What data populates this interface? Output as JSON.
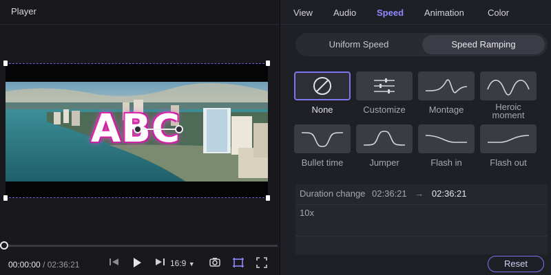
{
  "player": {
    "title": "Player",
    "overlay_text": "ABC",
    "current_time": "00:00:00",
    "separator": "/",
    "total_time": "02:36:21",
    "aspect_ratio": "16:9",
    "playhead_progress": 0
  },
  "icons": {
    "prev": "step-back-icon",
    "play": "play-icon",
    "next": "step-forward-icon",
    "dropdown": "chevron-down-icon",
    "snapshot": "camera-icon",
    "crop": "crop-icon",
    "fullscreen": "fullscreen-icon"
  },
  "tabs": [
    {
      "label": "View"
    },
    {
      "label": "Audio"
    },
    {
      "label": "Speed"
    },
    {
      "label": "Animation"
    },
    {
      "label": "Color"
    }
  ],
  "active_tab": "Speed",
  "speed_modes": {
    "uniform": "Uniform Speed",
    "ramping": "Speed Ramping",
    "selected": "Speed Ramping"
  },
  "presets": [
    {
      "label": "None",
      "icon": "none-icon"
    },
    {
      "label": "Customize",
      "icon": "sliders-icon"
    },
    {
      "label": "Montage",
      "icon": "montage-curve-icon"
    },
    {
      "label": "Heroic moment",
      "icon": "heroic-curve-icon"
    },
    {
      "label": "Bullet time",
      "icon": "bullet-time-curve-icon"
    },
    {
      "label": "Jumper",
      "icon": "jumper-curve-icon"
    },
    {
      "label": "Flash in",
      "icon": "flash-in-curve-icon"
    },
    {
      "label": "Flash out",
      "icon": "flash-out-curve-icon"
    }
  ],
  "selected_preset": "None",
  "duration": {
    "label": "Duration change",
    "from": "02:36:21",
    "arrow": "→",
    "to": "02:36:21"
  },
  "speed_value": "10x",
  "reset_label": "Reset",
  "colors": {
    "accent": "#7d76f2",
    "tab_active": "#8f88ff",
    "title_glow": "#ff2bb4"
  }
}
